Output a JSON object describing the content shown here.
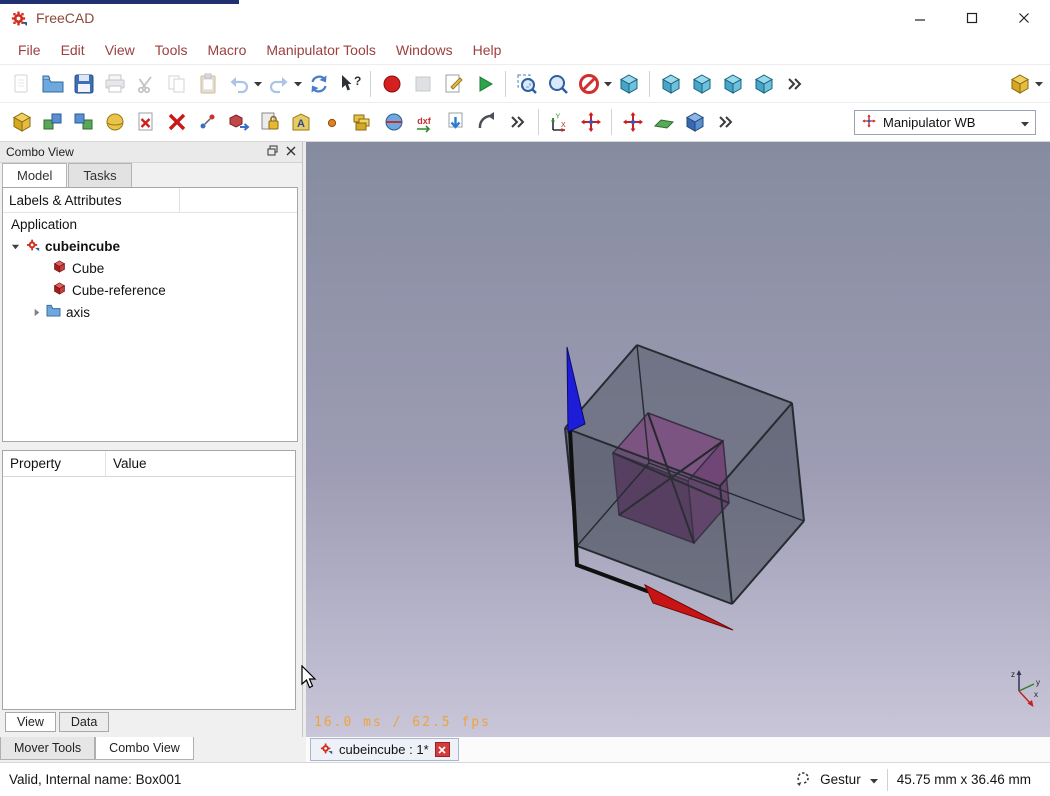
{
  "window": {
    "title": "FreeCAD"
  },
  "menu": {
    "items": [
      "File",
      "Edit",
      "View",
      "Tools",
      "Macro",
      "Manipulator Tools",
      "Windows",
      "Help"
    ]
  },
  "toolbars": {
    "standard": {
      "icons": [
        {
          "name": "document-new-icon",
          "glyph": "page",
          "disabled": true
        },
        {
          "name": "document-open-icon",
          "glyph": "folder"
        },
        {
          "name": "document-save-icon",
          "glyph": "floppy"
        },
        {
          "name": "print-icon",
          "glyph": "printer",
          "disabled": true
        },
        {
          "name": "cut-icon",
          "glyph": "scissors",
          "disabled": true
        },
        {
          "name": "copy-icon",
          "glyph": "copy",
          "disabled": true
        },
        {
          "name": "paste-icon",
          "glyph": "clipboard",
          "disabled": true
        },
        {
          "name": "undo-icon",
          "glyph": "undo",
          "disabled": true,
          "dropdown": true
        },
        {
          "name": "redo-icon",
          "glyph": "redo",
          "disabled": true,
          "dropdown": true
        },
        {
          "name": "refresh-icon",
          "glyph": "refresh"
        },
        {
          "name": "whats-this-icon",
          "glyph": "whatsthis"
        },
        {
          "separator": true
        },
        {
          "name": "macro-record-icon",
          "glyph": "record"
        },
        {
          "name": "macro-stop-icon",
          "glyph": "stop",
          "disabled": true
        },
        {
          "name": "macro-edit-icon",
          "glyph": "macroedit"
        },
        {
          "name": "macro-execute-icon",
          "glyph": "play"
        },
        {
          "separator": true
        },
        {
          "name": "view-fit-all-icon",
          "glyph": "zoomfit"
        },
        {
          "name": "view-zoom-icon",
          "glyph": "zoom"
        },
        {
          "name": "draw-style-icon",
          "glyph": "nodraw",
          "dropdown": true
        },
        {
          "name": "view-isometric-icon",
          "glyph": "viewcube"
        },
        {
          "separator": true
        },
        {
          "name": "view-front-icon",
          "glyph": "viewcube"
        },
        {
          "name": "view-top-icon",
          "glyph": "viewcube"
        },
        {
          "name": "view-right-icon",
          "glyph": "viewcube"
        },
        {
          "name": "view-axonometric-icon",
          "glyph": "viewcube"
        },
        {
          "name": "toolbar-overflow-icon",
          "glyph": "overflow"
        }
      ]
    },
    "standard_right": {
      "icons": [
        {
          "name": "part-workbench-icon",
          "glyph": "partbox",
          "dropdown": true
        }
      ]
    },
    "secondary": {
      "icons": [
        {
          "name": "part-box-icon",
          "glyph": "partbox"
        },
        {
          "name": "part-union-icon",
          "glyph": "twocubesA"
        },
        {
          "name": "part-common-icon",
          "glyph": "twocubesB"
        },
        {
          "name": "part-cylinder-icon",
          "glyph": "sphere"
        },
        {
          "name": "remove-shape-icon",
          "glyph": "xpage"
        },
        {
          "name": "delete-icon",
          "glyph": "redx"
        },
        {
          "name": "placement-icon",
          "glyph": "points"
        },
        {
          "name": "part-simple-copy-icon",
          "glyph": "cubearrow"
        },
        {
          "name": "clipboard-lock-icon",
          "glyph": "lockclip"
        },
        {
          "name": "shape-from-text-icon",
          "glyph": "shapeA"
        },
        {
          "name": "datum-point-icon",
          "glyph": "dot"
        },
        {
          "name": "part-compound-icon",
          "glyph": "compound"
        },
        {
          "name": "cross-section-icon",
          "glyph": "section"
        },
        {
          "name": "dxf-export-icon",
          "glyph": "dxf"
        },
        {
          "name": "import-file-icon",
          "glyph": "importarrow"
        },
        {
          "name": "revolve-icon",
          "glyph": "bend"
        },
        {
          "name": "toolbar-overflow-icon",
          "glyph": "overflow"
        },
        {
          "separator": true
        },
        {
          "name": "manipulator-aligner-icon",
          "glyph": "manipaxes"
        },
        {
          "name": "manipulator-mover-icon",
          "glyph": "manipmove"
        },
        {
          "separator": true
        },
        {
          "name": "manipulator-retranslate-icon",
          "glyph": "manipmove"
        },
        {
          "name": "manipulator-plane-icon",
          "glyph": "plane"
        },
        {
          "name": "manipulator-caliper-icon",
          "glyph": "bluecube"
        },
        {
          "name": "toolbar-overflow-icon",
          "glyph": "overflow"
        }
      ]
    },
    "workbench_selector": {
      "value": "Manipulator WB"
    }
  },
  "combo_view": {
    "title": "Combo View",
    "tabs": [
      {
        "label": "Model",
        "active": true
      },
      {
        "label": "Tasks",
        "active": false
      }
    ],
    "tree_header": "Labels & Attributes",
    "tree": {
      "root_label": "Application",
      "document_label": "cubeincube",
      "items": [
        "Cube",
        "Cube-reference",
        "axis"
      ]
    },
    "property_table": {
      "columns": [
        "Property",
        "Value"
      ],
      "rows": []
    },
    "editor_tabs": [
      "View",
      "Data"
    ]
  },
  "bottom_panel_tabs": [
    "Mover Tools",
    "Combo View"
  ],
  "document_tab": {
    "label": "cubeincube : 1*"
  },
  "viewport": {
    "overlay_text": "16.0 ms / 62.5 fps",
    "axis_labels": [
      "z",
      "y",
      "x"
    ],
    "colors": {
      "outer_cube": "#3d444e",
      "inner_cube_top": "#a85fa8",
      "inner_cube_right": "#934893",
      "inner_cube_left": "#7c3a7c",
      "arrow_up": "#1d1dd8",
      "arrow_down": "#c81414",
      "overlay_text": "#f0a23c",
      "background_top": "#868ca0",
      "background_bottom": "#c9c6d9"
    }
  },
  "status_bar": {
    "message": "Valid, Internal name: Box001",
    "nav_style_label": "Gestur",
    "dimensions_label": "45.75 mm x 36.46 mm"
  }
}
